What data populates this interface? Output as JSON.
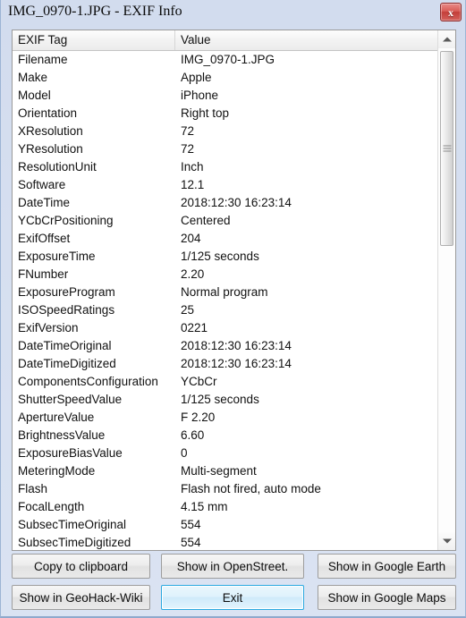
{
  "window": {
    "title": "IMG_0970-1.JPG - EXIF Info",
    "close_label": "x",
    "accent_focus_color": "#2aa8e0",
    "close_button_color": "#c33e39",
    "background_color": "#d6dff0"
  },
  "table": {
    "columns": [
      "EXIF Tag",
      "Value"
    ],
    "rows": [
      {
        "tag": "Filename",
        "value": "IMG_0970-1.JPG"
      },
      {
        "tag": "Make",
        "value": "Apple"
      },
      {
        "tag": "Model",
        "value": "iPhone"
      },
      {
        "tag": "Orientation",
        "value": "Right top"
      },
      {
        "tag": "XResolution",
        "value": "72"
      },
      {
        "tag": "YResolution",
        "value": "72"
      },
      {
        "tag": "ResolutionUnit",
        "value": "Inch"
      },
      {
        "tag": "Software",
        "value": "12.1"
      },
      {
        "tag": "DateTime",
        "value": "2018:12:30 16:23:14"
      },
      {
        "tag": "YCbCrPositioning",
        "value": "Centered"
      },
      {
        "tag": "ExifOffset",
        "value": "204"
      },
      {
        "tag": "ExposureTime",
        "value": "1/125 seconds"
      },
      {
        "tag": "FNumber",
        "value": "2.20"
      },
      {
        "tag": "ExposureProgram",
        "value": "Normal program"
      },
      {
        "tag": "ISOSpeedRatings",
        "value": "25"
      },
      {
        "tag": "ExifVersion",
        "value": "0221"
      },
      {
        "tag": "DateTimeOriginal",
        "value": "2018:12:30 16:23:14"
      },
      {
        "tag": "DateTimeDigitized",
        "value": "2018:12:30 16:23:14"
      },
      {
        "tag": "ComponentsConfiguration",
        "value": "YCbCr"
      },
      {
        "tag": "ShutterSpeedValue",
        "value": "1/125 seconds"
      },
      {
        "tag": "ApertureValue",
        "value": "F 2.20"
      },
      {
        "tag": "BrightnessValue",
        "value": "6.60"
      },
      {
        "tag": "ExposureBiasValue",
        "value": "0"
      },
      {
        "tag": "MeteringMode",
        "value": "Multi-segment"
      },
      {
        "tag": "Flash",
        "value": "Flash not fired, auto mode"
      },
      {
        "tag": "FocalLength",
        "value": "4.15 mm"
      },
      {
        "tag": "SubsecTimeOriginal",
        "value": "554"
      },
      {
        "tag": "SubsecTimeDigitized",
        "value": "554"
      }
    ]
  },
  "scrollbar": {
    "up_arrow": "scroll-up-arrow",
    "down_arrow": "scroll-down-arrow"
  },
  "buttons": {
    "copy_to_clipboard": "Copy to clipboard",
    "show_in_openstreet": "Show in OpenStreet.",
    "show_in_google_earth": "Show in Google Earth",
    "show_in_geohack_wiki": "Show in GeoHack-Wiki",
    "exit": "Exit",
    "show_in_google_maps": "Show in Google Maps"
  }
}
